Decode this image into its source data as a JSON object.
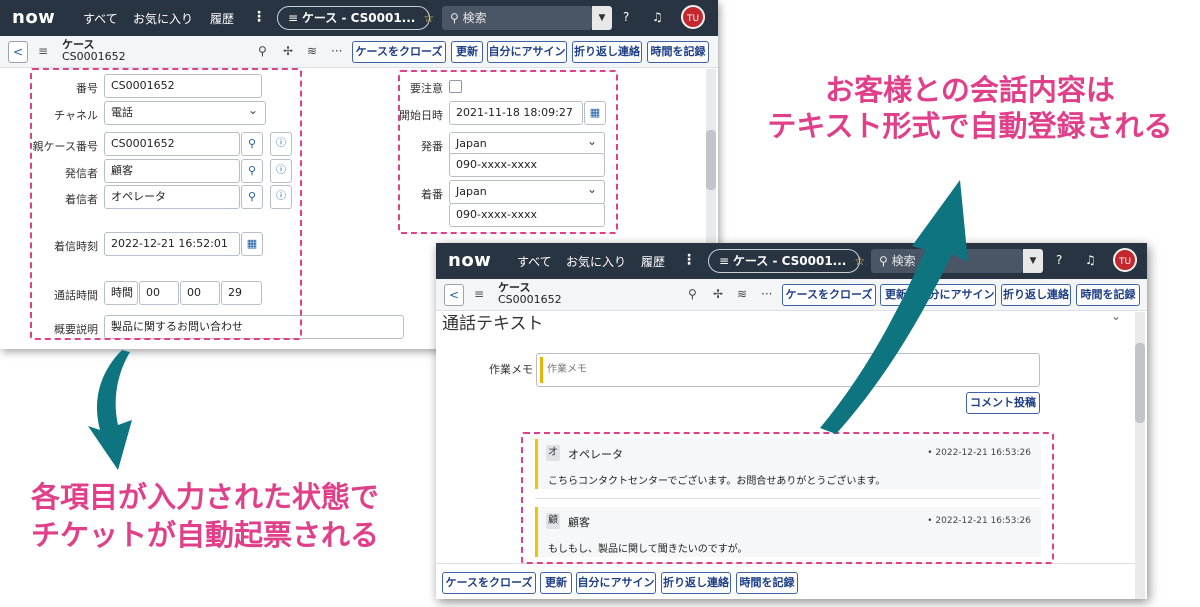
{
  "nav": {
    "logo": "now",
    "all": "すべて",
    "favorites": "お気に入り",
    "history": "履歴",
    "more": "⋮",
    "context_pill": "ケース - CS0001...",
    "search_placeholder": "検索",
    "avatar_initials": "TU"
  },
  "record": {
    "title": "ケース",
    "number": "CS0001652"
  },
  "toolbar": {
    "close_case": "ケースをクローズ",
    "update": "更新",
    "assign_to_me": "自分にアサイン",
    "callback": "折り返し連絡",
    "log_time": "時間を記録"
  },
  "form": {
    "number_label": "番号",
    "number_value": "CS0001652",
    "channel_label": "チャネル",
    "channel_value": "電話",
    "parent_case_label": "親ケース番号",
    "parent_case_value": "CS0001652",
    "caller_label": "発信者",
    "caller_value": "顧客",
    "callee_label": "着信者",
    "callee_value": "オペレータ",
    "received_time_label": "着信時刻",
    "received_time_value": "2022-12-21 16:52:01",
    "duration_label": "通話時間",
    "duration_unit": "時間",
    "duration_hours": "00",
    "duration_minutes": "00",
    "duration_seconds": "29",
    "summary_label": "概要説明",
    "summary_value": "製品に関するお問い合わせ",
    "attention_label": "要注意",
    "start_time_label": "開始日時",
    "start_time_value": "2021-11-18 18:09:27",
    "from_label": "発番",
    "from_country": "Japan",
    "from_number": "090-xxxx-xxxx",
    "to_label": "着番",
    "to_country": "Japan",
    "to_number": "090-xxxx-xxxx"
  },
  "transcript": {
    "section_title": "通話テキスト",
    "work_notes_label": "作業メモ",
    "work_notes_placeholder": "作業メモ",
    "post_comment": "コメント投稿",
    "entries": [
      {
        "initial": "オ",
        "author": "オペレータ",
        "timestamp": "• 2022-12-21 16:53:26",
        "message": "こちらコンタクトセンターでございます。お問合せありがとうございます。"
      },
      {
        "initial": "顧",
        "author": "顧客",
        "timestamp": "• 2022-12-21 16:53:26",
        "message": "もしもし、製品に関して聞きたいのですが。"
      }
    ]
  },
  "callouts": {
    "top_line1": "お客様との会話内容は",
    "top_line2": "テキスト形式で自動登録される",
    "bottom_line1": "各項目が入力された状態で",
    "bottom_line2": "チケットが自動起票される"
  },
  "colors": {
    "nav_bg": "#293442",
    "accent_pink": "#e0408a",
    "arrow_teal": "#0d7480",
    "button_blue": "#1e3f86"
  }
}
